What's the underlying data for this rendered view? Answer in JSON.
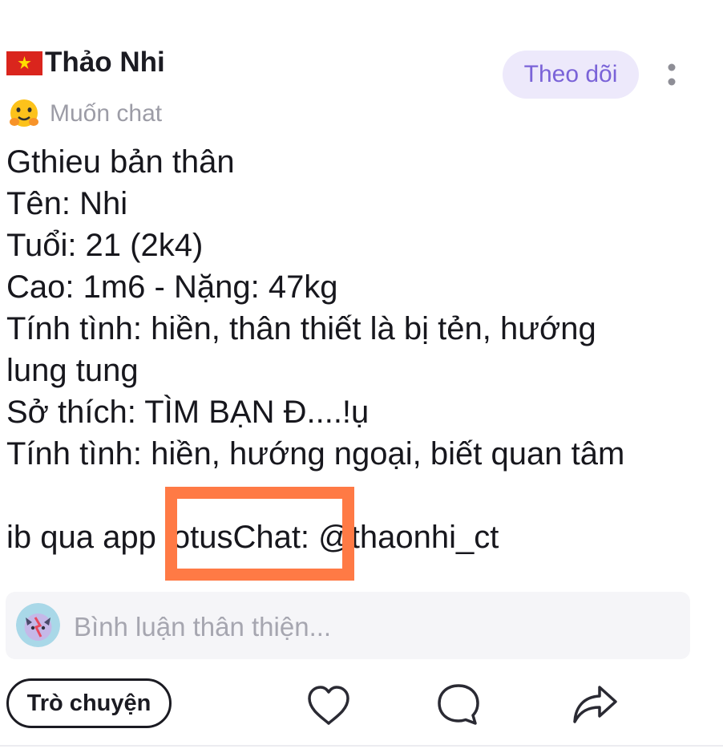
{
  "user": {
    "flag_icon": "vietnam-flag-icon",
    "name": "Thảo Nhi",
    "status_icon": "hugging-face-emoji-icon",
    "status": "Muốn chat"
  },
  "header": {
    "follow_label": "Theo dõi",
    "more_icon": "more-vertical-icon"
  },
  "post": {
    "lines": [
      "Gthieu bản thân",
      "Tên: Nhi",
      "Tuổi: 21 (2k4)",
      "Cao: 1m6 - Nặng: 47kg",
      "Tính tình: hiền, thân thiết là bị tẻn, hướng",
      "lung tung",
      "Sở thích: TÌM BẠN Đ....!ụ",
      "Tính tình: hiền, hướng ngoại, biết quan tâm",
      "",
      "ib qua app lotusChat: @thaonhi_ct"
    ]
  },
  "comment": {
    "placeholder": "Bình luận thân thiện...",
    "avatar_icon": "user-avatar-icon"
  },
  "actions": {
    "chat_label": "Trò chuyện",
    "like_icon": "heart-icon",
    "comment_icon": "comment-icon",
    "share_icon": "share-icon"
  },
  "colors": {
    "accent": "#7a63d8",
    "accent_bg": "#ede9fb",
    "highlight": "#ff7a45",
    "muted_text": "#9c9ca6"
  }
}
